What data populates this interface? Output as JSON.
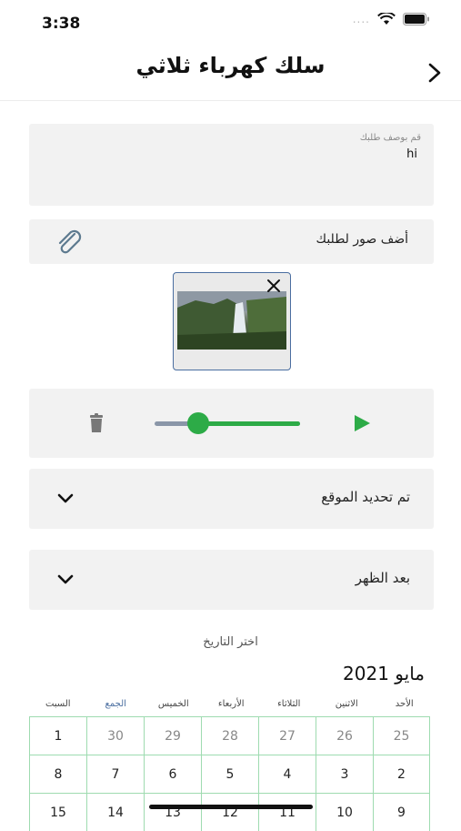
{
  "status_bar": {
    "time": "3:38",
    "signal_dots": "....",
    "wifi_icon": "wifi-icon",
    "battery_icon": "battery-icon"
  },
  "header": {
    "title": "سلك كهرباء ثلاثي",
    "back_icon": "chevron-right-icon"
  },
  "description": {
    "label": "قم بوصف طلبك",
    "value": "hi"
  },
  "photos": {
    "label": "أضف صور لطلبك",
    "icon": "paperclip-icon"
  },
  "audio": {
    "progress": 0.3,
    "accent": "#2dab47",
    "track_color": "#8a96a8"
  },
  "location": {
    "label": "تم تحديد الموقع"
  },
  "time_period": {
    "label": "بعد الظهر"
  },
  "date_picker": {
    "title": "اختر التاريخ",
    "month": "مايو 2021",
    "weekdays": [
      "الأحد",
      "الاثنين",
      "الثلاثاء",
      "الأربعاء",
      "الخميس",
      "الجمع",
      "السبت"
    ],
    "weeks": [
      [
        "25",
        "26",
        "27",
        "28",
        "29",
        "30",
        "1"
      ],
      [
        "2",
        "3",
        "4",
        "5",
        "6",
        "7",
        "8"
      ],
      [
        "9",
        "10",
        "11",
        "12",
        "13",
        "14",
        "15"
      ]
    ],
    "muted_first_row": [
      "25",
      "26",
      "27",
      "28",
      "29",
      "30"
    ],
    "grid_color": "#9edbb0",
    "highlight_weekday_color": "#4a6ea0"
  }
}
